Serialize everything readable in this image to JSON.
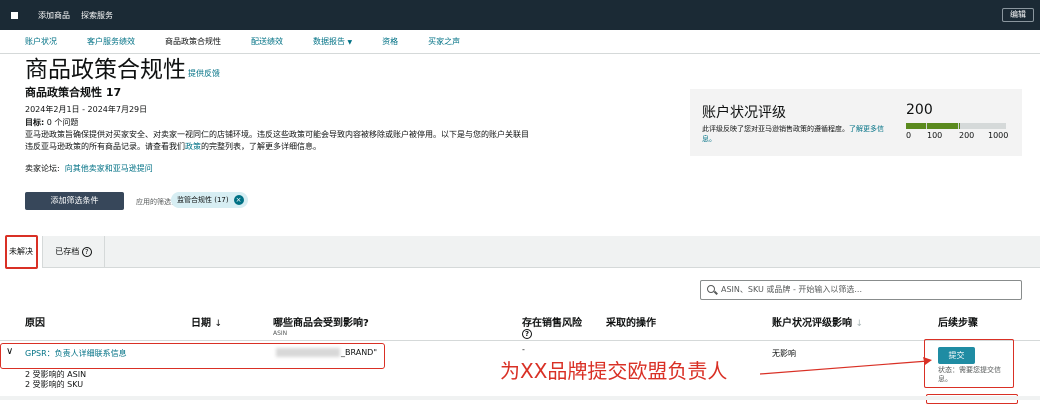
{
  "topbar": {
    "add_product": "添加商品",
    "explore_services": "探索服务",
    "edit": "编辑"
  },
  "nav": [
    {
      "label": "账户状况"
    },
    {
      "label": "客户服务绩效"
    },
    {
      "label": "商品政策合规性"
    },
    {
      "label": "配送绩效"
    },
    {
      "label": "数据报告"
    },
    {
      "label": "资格"
    },
    {
      "label": "买家之声"
    }
  ],
  "header": {
    "title": "商品政策合规性",
    "feedback": "提供反馈",
    "subtitle": "商品政策合规性 17",
    "date_range": "2024年2月1日 - 2024年7月29日",
    "goal_label": "目标:",
    "goal_value": "0 个问题",
    "desc_part1": "亚马逊政策旨确保提供对买家安全、对卖家一视同仁的店铺环境。违反这些政策可能会导致内容被移除或账户被停用。以下是与您的账户关联目违反亚马逊政策的所有商品记录。请查看我们",
    "desc_link": "政策",
    "desc_part2": "的完整列表，了解更多详细信息。",
    "forum_label": "卖家论坛:",
    "forum_link": "向其他卖家和亚马逊提问"
  },
  "filters": {
    "add_button": "添加筛选条件",
    "applied_label": "应用的筛选条件:",
    "chip": "监管合规性 (17)",
    "chip_close": "×"
  },
  "health_card": {
    "title": "账户状况评级",
    "desc": "此评级反映了您对亚马逊销售政策的遵循程度。",
    "link": "了解更多信息。",
    "score": "200",
    "score_value": 200,
    "scale": [
      "0",
      "100",
      "200",
      "1000"
    ]
  },
  "tabs": {
    "open": "未解决",
    "saved": "已存档",
    "help": "?"
  },
  "search": {
    "placeholder": "ASIN、SKU 或品牌 - 开始输入以筛选..."
  },
  "columns": {
    "reason": "原因",
    "date": "日期",
    "date_arrow": "↓",
    "affected": "哪些商品会受到影响?",
    "affected_sub": "ASIN",
    "risk": "存在销售风险",
    "risk_help": "?",
    "action": "采取的操作",
    "impact": "账户状况评级影响",
    "impact_arrow": "↓",
    "next": "后续步骤"
  },
  "row": {
    "chevron": "∨",
    "reason": "GPSR：负责人详细联系信息",
    "asin_suffix": "_BRAND\"",
    "risk": "-",
    "impact": "无影响",
    "submit": "提交",
    "status": "状态：需要您提交信息。",
    "affected_asin": "2 受影响的 ASIN",
    "affected_sku": "2 受影响的 SKU"
  },
  "annotation": "为XX品牌提交欧盟负责人",
  "colors": {
    "topbar": "#1b2a35",
    "link": "#007185",
    "annotation": "#d93025",
    "button": "#1f8ca3"
  }
}
